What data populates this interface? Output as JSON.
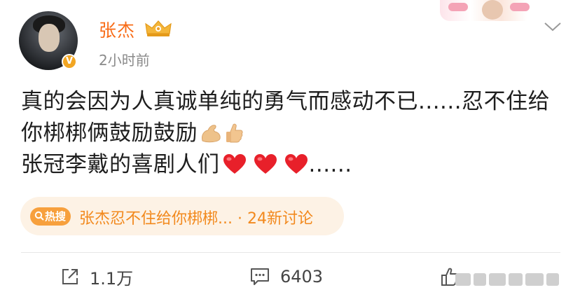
{
  "post": {
    "username": "张杰",
    "timestamp": "2小时前",
    "verified_badge": "V",
    "content_lines": [
      "真的会因为人真诚单纯的勇气而感动不已......忍不住给",
      "你梆梆俩鼓励鼓励",
      "张冠李戴的喜剧人们",
      "......"
    ],
    "emojis_line2": [
      "flexed-biceps",
      "thumbs-up"
    ],
    "emojis_line3": [
      "red-heart",
      "red-heart",
      "red-heart"
    ]
  },
  "hot_search": {
    "tag_label": "热搜",
    "text": "张杰忍不住给你梆梆... · 24新讨论"
  },
  "actions": {
    "repost_count": "1.1万",
    "comment_count": "6403"
  },
  "colors": {
    "username": "#f86b16",
    "hot_bg": "#fdf2e5",
    "hot_text": "#f2891d",
    "badge": "#f2a623"
  },
  "icons": {
    "repost": "share-icon",
    "comment": "comment-icon",
    "like": "thumbs-up-icon",
    "more": "chevron-down-icon",
    "crown": "crown-badge-icon"
  }
}
